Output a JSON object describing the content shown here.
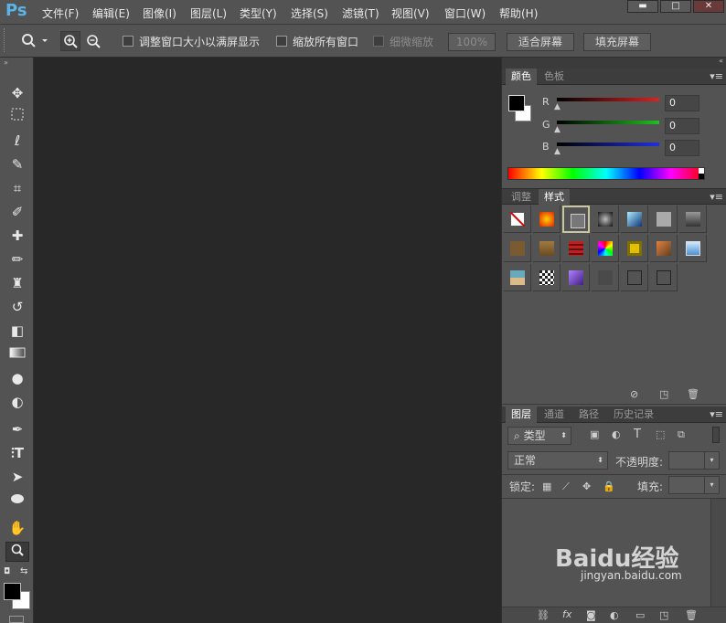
{
  "app": {
    "logo": "Ps"
  },
  "menu": [
    "文件(F)",
    "编辑(E)",
    "图像(I)",
    "图层(L)",
    "类型(Y)",
    "选择(S)",
    "滤镜(T)",
    "视图(V)",
    "窗口(W)",
    "帮助(H)"
  ],
  "window": {
    "minimize": "▬",
    "restore": "□",
    "close": "✕"
  },
  "options": {
    "resize_windows": "调整窗口大小以满屏显示",
    "zoom_all": "缩放所有窗口",
    "scrubby": "细微缩放",
    "zoom_value": "100%",
    "fit_screen": "适合屏幕",
    "fill_screen": "填充屏幕"
  },
  "color_panel": {
    "tabs": [
      "颜色",
      "色板"
    ],
    "channels": [
      {
        "label": "R",
        "value": "0",
        "color": "#e02020"
      },
      {
        "label": "G",
        "value": "0",
        "color": "#20c020"
      },
      {
        "label": "B",
        "value": "0",
        "color": "#2030e0"
      }
    ]
  },
  "styles_panel": {
    "tabs": [
      "调整",
      "样式"
    ]
  },
  "layers_panel": {
    "tabs": [
      "图层",
      "通道",
      "路径",
      "历史记录"
    ],
    "filter_kind": "类型",
    "blend_mode": "正常",
    "opacity_label": "不透明度:",
    "lock_label": "锁定:",
    "fill_label": "填充:"
  },
  "watermark": {
    "brand": "Baidu经验",
    "url": "jingyan.baidu.com"
  }
}
